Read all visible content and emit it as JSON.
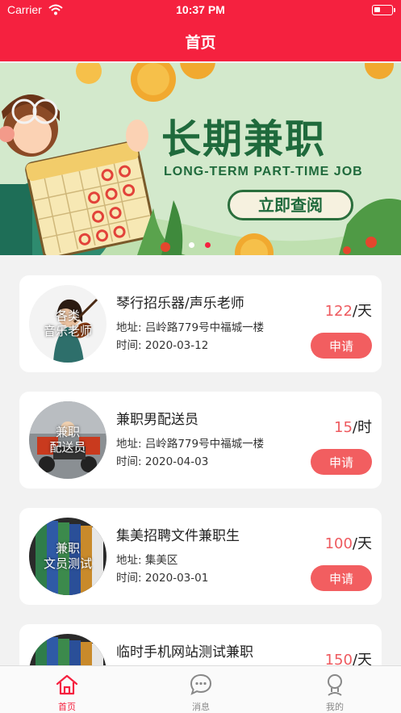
{
  "status_bar": {
    "carrier": "Carrier",
    "time": "10:37 PM"
  },
  "nav": {
    "title": "首页"
  },
  "banner": {
    "headline": "长期兼职",
    "subline": "LONG-TERM PART-TIME JOB",
    "cta": "立即查阅",
    "active_slide": 2,
    "slide_count": 2
  },
  "jobs": [
    {
      "thumb_text": [
        "各类",
        "音乐老师"
      ],
      "title": "琴行招乐器/声乐老师",
      "address": "地址: 吕岭路779号中福城一楼",
      "time": "时间: 2020-03-12",
      "price": "122",
      "unit": "/天",
      "apply": "申请"
    },
    {
      "thumb_text": [
        "兼职",
        "配送员"
      ],
      "title": "兼职男配送员",
      "address": "地址: 吕岭路779号中福城一楼",
      "time": "时间: 2020-04-03",
      "price": "15",
      "unit": "/时",
      "apply": "申请"
    },
    {
      "thumb_text": [
        "兼职",
        "文员测试"
      ],
      "title": "集美招聘文件兼职生",
      "address": "地址: 集美区",
      "time": "时间: 2020-03-01",
      "price": "100",
      "unit": "/天",
      "apply": "申请"
    },
    {
      "thumb_text": [
        "兼职",
        ""
      ],
      "title": "临时手机网站测试兼职",
      "address": "",
      "time": "",
      "price": "150",
      "unit": "/天",
      "apply": "申请"
    }
  ],
  "tabs": [
    {
      "label": "首页",
      "icon": "home-icon",
      "active": true
    },
    {
      "label": "消息",
      "icon": "chat-bubble-icon",
      "active": false
    },
    {
      "label": "我的",
      "icon": "person-icon",
      "active": false
    }
  ],
  "colors": {
    "brand": "#f5213f",
    "price": "#ee5a5f",
    "apply": "#f25e60",
    "tab_inactive": "#888888"
  }
}
